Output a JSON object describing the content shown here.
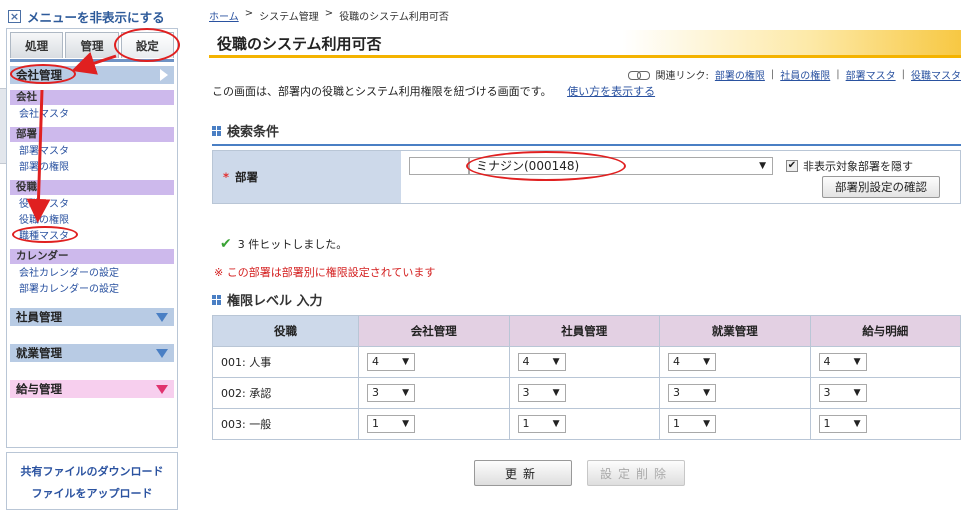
{
  "sidebar": {
    "hide_menu_label": "メニューを非表示にする",
    "tabs": [
      {
        "label": "処理"
      },
      {
        "label": "管理"
      },
      {
        "label": "設定"
      }
    ],
    "company_group": "会社管理",
    "sections": [
      {
        "title": "会社",
        "links": [
          "会社マスタ"
        ]
      },
      {
        "title": "部署",
        "links": [
          "部署マスタ",
          "部署の権限"
        ]
      },
      {
        "title": "役職",
        "links": [
          "役職マスタ",
          "役職の権限",
          "職種マスタ"
        ]
      },
      {
        "title": "カレンダー",
        "links": [
          "会社カレンダーの設定",
          "部署カレンダーの設定"
        ]
      }
    ],
    "groups": [
      "社員管理",
      "就業管理",
      "給与管理"
    ],
    "bottom": {
      "download": "共有ファイルのダウンロード",
      "upload": "ファイルをアップロード"
    }
  },
  "breadcrumb": {
    "home": "ホーム",
    "sep": ">",
    "system": "システム管理",
    "current": "役職のシステム利用可否"
  },
  "page_title": "役職のシステム利用可否",
  "related": {
    "label": "関連リンク:",
    "links": [
      "部署の権限",
      "社員の権限",
      "部署マスタ",
      "役職マスタ"
    ]
  },
  "description": "この画面は、部署内の役職とシステム利用権限を紐づける画面です。",
  "how_to_link": "使い方を表示する",
  "search": {
    "section_title": "検索条件",
    "required_mark": "*",
    "dept_label": "部署",
    "code_value": "",
    "dept_value": "ミナジン(000148)",
    "hide_label": "非表示対象部署を隠す",
    "hide_checked": true,
    "confirm_button": "部署別設定の確認"
  },
  "hit_message": "3 件ヒットしました。",
  "warning_message": "※ この部署は部署別に権限設定されています",
  "perm": {
    "section_title": "権限レベル 入力",
    "columns": [
      "役職",
      "会社管理",
      "社員管理",
      "就業管理",
      "給与明細"
    ],
    "rows": [
      {
        "role": "001: 人事",
        "values": [
          "4",
          "4",
          "4",
          "4"
        ]
      },
      {
        "role": "002: 承認",
        "values": [
          "3",
          "3",
          "3",
          "3"
        ]
      },
      {
        "role": "003: 一般",
        "values": [
          "1",
          "1",
          "1",
          "1"
        ]
      }
    ]
  },
  "buttons": {
    "update": "更新",
    "delete": "設定削除"
  },
  "colors": {
    "accent": "#4a7fc4",
    "annotation": "#e02020",
    "title_bar": "#f4b300"
  }
}
